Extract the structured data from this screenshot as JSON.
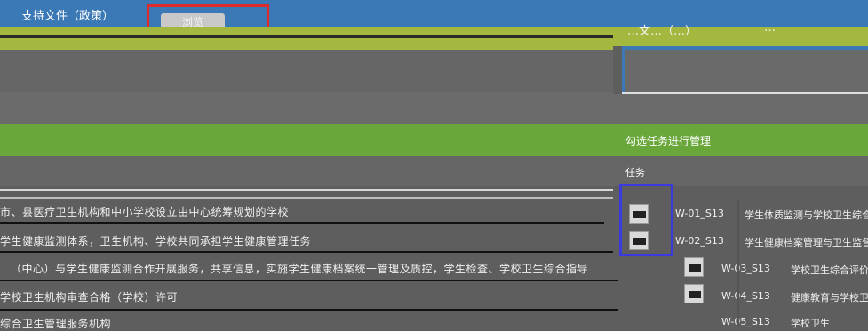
{
  "top_bar": {
    "title": "支持文件（政策）",
    "preview_tab": "浏览"
  },
  "right_panel": {
    "title1": "…文…（…）",
    "title2": "…",
    "manage_label": "勾选任务进行管理",
    "task_header": "任务"
  },
  "content_rows": [
    "市、县医疗卫生机构和中小学校设立由中心统筹规划的学校",
    "学生健康监测体系，卫生机构、学校共同承担学生健康管理任务",
    "（中心）与学生健康监测合作开展服务，共享信息，实施学生健康档案统一管理及质控，学生检查、学校卫生综合指导",
    "学校卫生机构审查合格（学校）许可",
    "综合卫生管理服务机构"
  ],
  "tasks": [
    {
      "code": "W-01_S13",
      "desc": "学生体质监测与学校卫生综合"
    },
    {
      "code": "W-02_S13",
      "desc": "学生健康档案管理与卫生监督"
    },
    {
      "code": "W-03_S13",
      "desc": "学校卫生综合评价"
    },
    {
      "code": "W-04_S13",
      "desc": "健康教育与学校卫生"
    },
    {
      "code": "W-05_S13",
      "desc": "学校卫生"
    }
  ],
  "colors": {
    "top_bar": "#3a78b6",
    "accent_green": "#6aa73a",
    "olive_band": "#a4b840",
    "highlight_red": "#e02b2b",
    "highlight_blue": "#3a3ae0"
  }
}
